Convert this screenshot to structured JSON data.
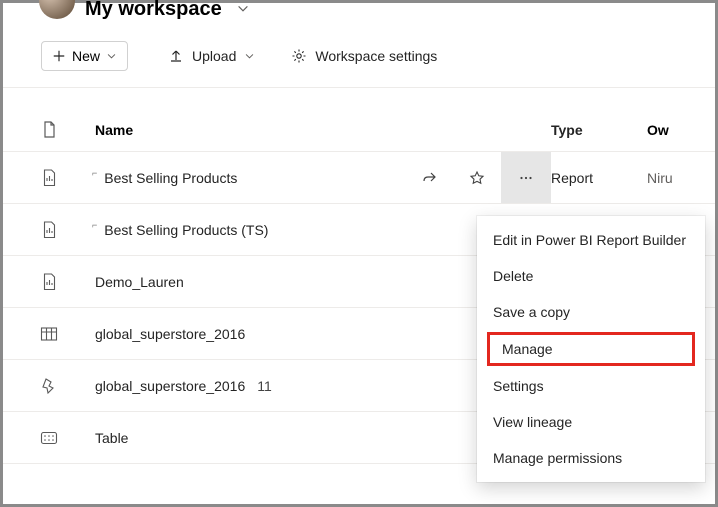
{
  "header": {
    "workspace_title": "My workspace"
  },
  "toolbar": {
    "new_label": "New",
    "upload_label": "Upload",
    "settings_label": "Workspace settings"
  },
  "columns": {
    "name": "Name",
    "type": "Type",
    "owner": "Ow"
  },
  "rows": [
    {
      "icon": "report-icon",
      "name": "Best Selling Products",
      "corner": true,
      "share": true,
      "star": true,
      "more": true,
      "type": "Report",
      "owner": "Niru"
    },
    {
      "icon": "report-icon",
      "name": "Best Selling Products (TS)",
      "corner": true
    },
    {
      "icon": "report-icon",
      "name": "Demo_Lauren"
    },
    {
      "icon": "dataset-icon",
      "name": "global_superstore_2016"
    },
    {
      "icon": "dataflow-icon",
      "name": "global_superstore_2016",
      "badge": "11"
    },
    {
      "icon": "table-icon",
      "name": "Table"
    }
  ],
  "context_menu": {
    "items": [
      "Edit in Power BI Report Builder",
      "Delete",
      "Save a copy",
      "Manage",
      "Settings",
      "View lineage",
      "Manage permissions"
    ],
    "highlight_index": 3
  }
}
